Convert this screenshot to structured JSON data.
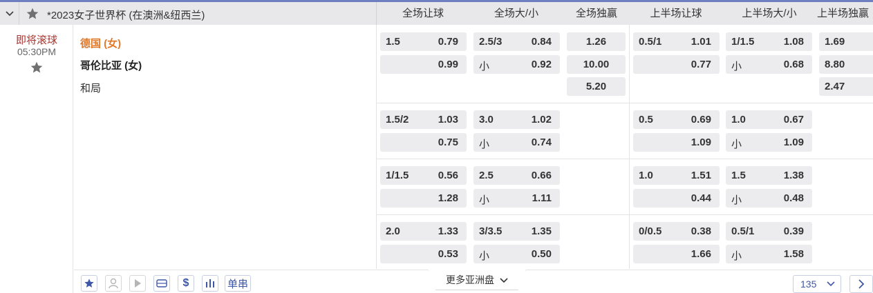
{
  "header": {
    "league_title": "*2023女子世界杯 (在澳洲&纽西兰)",
    "columns": [
      "全场让球",
      "全场大/小",
      "全场独赢",
      "上半场让球",
      "上半场大/小",
      "上半场独赢"
    ]
  },
  "match": {
    "status": "即将滚球",
    "time": "05:30PM",
    "home": "德国 (女)",
    "away": "哥伦比亚 (女)",
    "draw": "和局"
  },
  "lines": [
    {
      "ft_hdp": {
        "line": "1.5",
        "home": "0.79",
        "away": "0.99"
      },
      "ft_ou": {
        "line": "2.5/3",
        "over": "0.84",
        "under_label": "小",
        "under": "0.92"
      },
      "ft_1x2": {
        "home": "1.26",
        "away": "10.00",
        "draw": "5.20"
      },
      "ht_hdp": {
        "line": "0.5/1",
        "home": "1.01",
        "away": "0.77"
      },
      "ht_ou": {
        "line": "1/1.5",
        "over": "1.08",
        "under_label": "小",
        "under": "0.68"
      },
      "ht_1x2": {
        "home": "1.69",
        "away": "8.80",
        "draw": "2.47"
      }
    },
    {
      "ft_hdp": {
        "line": "1.5/2",
        "home": "1.03",
        "away": "0.75"
      },
      "ft_ou": {
        "line": "3.0",
        "over": "1.02",
        "under_label": "小",
        "under": "0.74"
      },
      "ht_hdp": {
        "line": "0.5",
        "home": "0.69",
        "away": "1.09"
      },
      "ht_ou": {
        "line": "1.0",
        "over": "0.67",
        "under_label": "小",
        "under": "1.09"
      }
    },
    {
      "ft_hdp": {
        "line": "1/1.5",
        "home": "0.56",
        "away": "1.28"
      },
      "ft_ou": {
        "line": "2.5",
        "over": "0.66",
        "under_label": "小",
        "under": "1.11"
      },
      "ht_hdp": {
        "line": "1.0",
        "home": "1.51",
        "away": "0.44"
      },
      "ht_ou": {
        "line": "1.5",
        "over": "1.38",
        "under_label": "小",
        "under": "0.48"
      }
    },
    {
      "ft_hdp": {
        "line": "2.0",
        "home": "1.33",
        "away": "0.53"
      },
      "ft_ou": {
        "line": "3/3.5",
        "over": "1.35",
        "under_label": "小",
        "under": "0.50"
      },
      "ht_hdp": {
        "line": "0/0.5",
        "home": "0.38",
        "away": "1.66"
      },
      "ht_ou": {
        "line": "0.5/1",
        "over": "0.39",
        "under_label": "小",
        "under": "1.58"
      }
    }
  ],
  "footer": {
    "parlay_label": "单串",
    "more_label": "更多亚洲盘",
    "count": "135",
    "icons": [
      "star-icon",
      "live-streamer-icon",
      "play-icon",
      "ticket-icon",
      "dollar-icon",
      "bar-chart-icon"
    ]
  },
  "colors": {
    "accent": "#3e57a6",
    "home_team": "#e07a2b",
    "status": "#a8322d",
    "odds_bg": "#ececee"
  }
}
